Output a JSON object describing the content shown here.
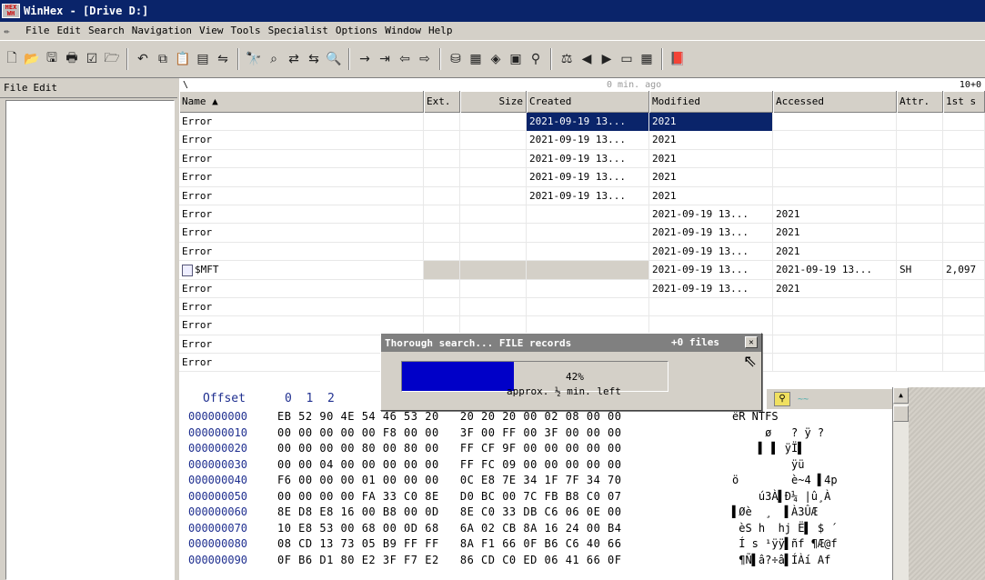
{
  "window": {
    "app_icon_text_top": "HEX",
    "app_icon_text_bottom": "WH",
    "title": "WinHex - [Drive D:]"
  },
  "menu": {
    "items": [
      "File",
      "Edit",
      "Search",
      "Navigation",
      "View",
      "Tools",
      "Specialist",
      "Options",
      "Window",
      "Help"
    ]
  },
  "toolbar": {
    "icons": [
      "new-icon",
      "open-icon",
      "save-icon",
      "print-icon",
      "properties-icon",
      "open-disk-icon",
      "undo-icon",
      "copy-block-icon",
      "clipboard-data-icon",
      "paste-icon",
      "convert-icon",
      "find-text-icon",
      "find-hex-icon",
      "replace-text-icon",
      "replace-hex-icon",
      "find-again-icon",
      "goto-offset-icon",
      "goto-sector-icon",
      "back-icon",
      "forward-icon",
      "disk-editor-icon",
      "ram-editor-icon",
      "data-interpreter-icon",
      "calculator-icon",
      "zoom-icon",
      "compare-icon",
      "prev-icon",
      "next-icon",
      "folder-icon",
      "table-icon",
      "help-book-icon"
    ]
  },
  "left_panel": {
    "menu": [
      "File",
      "Edit"
    ]
  },
  "path_bar": {
    "path": "\\",
    "ago": "0 min. ago",
    "count": "10+0"
  },
  "table": {
    "columns": [
      "Name ▲",
      "Ext.",
      "Size",
      "Created",
      "Modified",
      "Accessed",
      "Attr.",
      "1st s"
    ],
    "rows": [
      {
        "name": "Error",
        "ext": "",
        "size": "",
        "created": "2021-09-19  13...",
        "modified": "2021",
        "accessed": "",
        "attr": "",
        "first": "",
        "selected": true
      },
      {
        "name": "Error",
        "ext": "",
        "size": "",
        "created": "2021-09-19  13...",
        "modified": "2021",
        "accessed": "",
        "attr": "",
        "first": ""
      },
      {
        "name": "Error",
        "ext": "",
        "size": "",
        "created": "2021-09-19  13...",
        "modified": "2021",
        "accessed": "",
        "attr": "",
        "first": ""
      },
      {
        "name": "Error",
        "ext": "",
        "size": "",
        "created": "2021-09-19  13...",
        "modified": "2021",
        "accessed": "",
        "attr": "",
        "first": ""
      },
      {
        "name": "Error",
        "ext": "",
        "size": "",
        "created": "2021-09-19  13...",
        "modified": "2021",
        "accessed": "",
        "attr": "",
        "first": ""
      },
      {
        "name": "Error",
        "ext": "",
        "size": "",
        "created": "",
        "modified": "2021-09-19  13...",
        "accessed": "2021",
        "attr": "",
        "first": ""
      },
      {
        "name": "Error",
        "ext": "",
        "size": "",
        "created": "",
        "modified": "2021-09-19  13...",
        "accessed": "2021",
        "attr": "",
        "first": ""
      },
      {
        "name": "Error",
        "ext": "",
        "size": "",
        "created": "",
        "modified": "2021-09-19  13...",
        "accessed": "2021",
        "attr": "",
        "first": ""
      },
      {
        "name": "$MFT",
        "ext": "",
        "size": "",
        "created": "",
        "modified": "2021-09-19  13...",
        "accessed": "2021-09-19  13...",
        "attr": "SH",
        "first": "2,097",
        "icon": true
      },
      {
        "name": "Error",
        "ext": "",
        "size": "",
        "created": "",
        "modified": "2021-09-19  13...",
        "accessed": "2021",
        "attr": "",
        "first": ""
      },
      {
        "name": "Error",
        "ext": "",
        "size": "",
        "created": "",
        "modified": "",
        "accessed": "",
        "attr": "",
        "first": ""
      },
      {
        "name": "Error",
        "ext": "",
        "size": "",
        "created": "",
        "modified": "",
        "accessed": "",
        "attr": "",
        "first": ""
      },
      {
        "name": "Error",
        "ext": "",
        "size": "",
        "created": "",
        "modified": "",
        "accessed": "",
        "attr": "",
        "first": ""
      },
      {
        "name": "Error",
        "ext": "",
        "size": "",
        "created": "",
        "modified": "",
        "accessed": "",
        "attr": "",
        "first": ""
      }
    ]
  },
  "hex": {
    "header_label": "Offset",
    "header_cols": "0  1  2",
    "lines": [
      {
        "offset": "000000000",
        "bytes": "EB 52 90 4E 54 46 53 20   20 20 20 00 02 08 00 00",
        "ascii": "ëR NTFS"
      },
      {
        "offset": "000000010",
        "bytes": "00 00 00 00 00 F8 00 00   3F 00 FF 00 3F 00 00 00",
        "ascii": "     ø   ? ÿ ?"
      },
      {
        "offset": "000000020",
        "bytes": "00 00 00 00 80 00 80 00   FF CF 9F 00 00 00 00 00",
        "ascii": "    ▌ ▌ ÿÏ▌"
      },
      {
        "offset": "000000030",
        "bytes": "00 00 04 00 00 00 00 00   FF FC 09 00 00 00 00 00",
        "ascii": "         ÿü"
      },
      {
        "offset": "000000040",
        "bytes": "F6 00 00 00 01 00 00 00   0C E8 7E 34 1F 7F 34 70",
        "ascii": "ö        è~4 ▌4p"
      },
      {
        "offset": "000000050",
        "bytes": "00 00 00 00 FA 33 C0 8E   D0 BC 00 7C FB B8 C0 07",
        "ascii": "    ú3À▌Ð¼ |û¸À"
      },
      {
        "offset": "000000060",
        "bytes": "8E D8 E8 16 00 B8 00 0D   8E C0 33 DB C6 06 0E 00",
        "ascii": "▌Øè  ¸  ▌À3ÛÆ"
      },
      {
        "offset": "000000070",
        "bytes": "10 E8 53 00 68 00 0D 68   6A 02 CB 8A 16 24 00 B4",
        "ascii": " èS h  hj Ë▌ $ ´"
      },
      {
        "offset": "000000080",
        "bytes": "08 CD 13 73 05 B9 FF FF   8A F1 66 0F B6 C6 40 66",
        "ascii": " Í s ¹ÿÿ▌ñf ¶Æ@f"
      },
      {
        "offset": "000000090",
        "bytes": "0F B6 D1 80 E2 3F F7 E2   86 CD C0 ED 06 41 66 0F",
        "ascii": " ¶Ñ▌â?÷â▌ÍÀí Af "
      }
    ]
  },
  "dialog": {
    "title": "Thorough search... FILE records",
    "files": "+0 files",
    "progress": 0.42,
    "percent_text": "42%",
    "time_left": "approx. ½ min. left",
    "fill_color": "#0000c8"
  }
}
